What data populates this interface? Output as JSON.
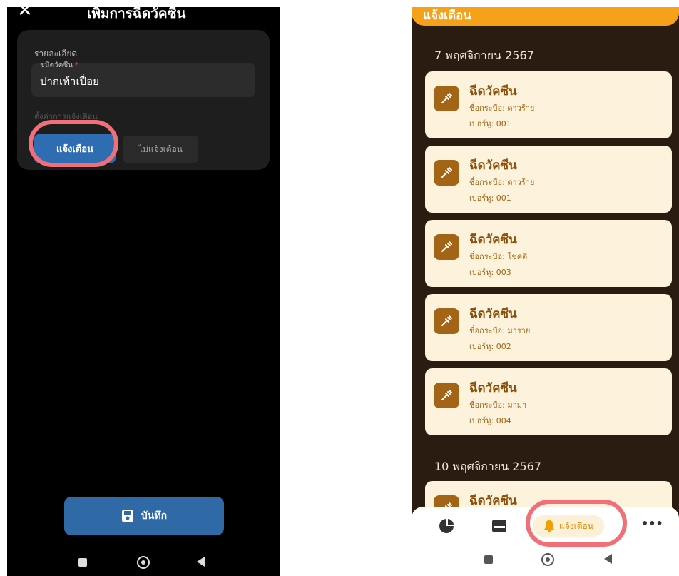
{
  "left": {
    "title": "เพิ่มการฉีดวัคซีน",
    "close_icon": "close-icon",
    "section_label": "รายละเอียด",
    "vaccine_field": {
      "label": "ชนิดวัคซีน",
      "required_mark": "*",
      "value": "ปากเท้าเปื่อย"
    },
    "notify_section_label": "ตั้งค่าการแจ้งเตือน",
    "notify_button": "แจ้งเตือน",
    "no_notify_button": "ไม่แจ้งเตือน",
    "save_button": "บันทึก",
    "colors": {
      "primary": "#2f6db3",
      "background": "#000000",
      "card": "#1e1e1e",
      "highlight_ring": "#f26f78"
    }
  },
  "right": {
    "header_title": "แจ้งเตือน",
    "groups": [
      {
        "date": "7 พฤศจิกายน 2567",
        "items": [
          {
            "title": "ฉีดวัคซีน",
            "name": "ชื่อกระบือ: ดาวร้าย",
            "number": "เบอร์หู: 001"
          },
          {
            "title": "ฉีดวัคซีน",
            "name": "ชื่อกระบือ: ดาวร้าย",
            "number": "เบอร์หู: 001"
          },
          {
            "title": "ฉีดวัคซีน",
            "name": "ชื่อกระบือ: โชคดี",
            "number": "เบอร์หู: 003"
          },
          {
            "title": "ฉีดวัคซีน",
            "name": "ชื่อกระบือ: มาราย",
            "number": "เบอร์หู: 002"
          },
          {
            "title": "ฉีดวัคซีน",
            "name": "ชื่อกระบือ: มาม่า",
            "number": "เบอร์หู: 004"
          }
        ]
      },
      {
        "date": "10 พฤศจิกายน 2567",
        "items": [
          {
            "title": "ฉีดวัคซีน",
            "name": "",
            "number": ""
          }
        ]
      }
    ],
    "bottom_nav": {
      "tabs": [
        {
          "icon": "pie-chart-icon"
        },
        {
          "icon": "card-icon"
        },
        {
          "icon": "bell-icon",
          "label": "แจ้งเตือน",
          "active": true
        },
        {
          "icon": "more-icon",
          "label": "•••"
        }
      ]
    },
    "colors": {
      "accent": "#f5a21a",
      "background": "#2a1c10",
      "card": "#fdf3dc",
      "icon_bg": "#a36415",
      "title": "#8a4f0a",
      "highlight_ring": "#f26f78"
    }
  }
}
